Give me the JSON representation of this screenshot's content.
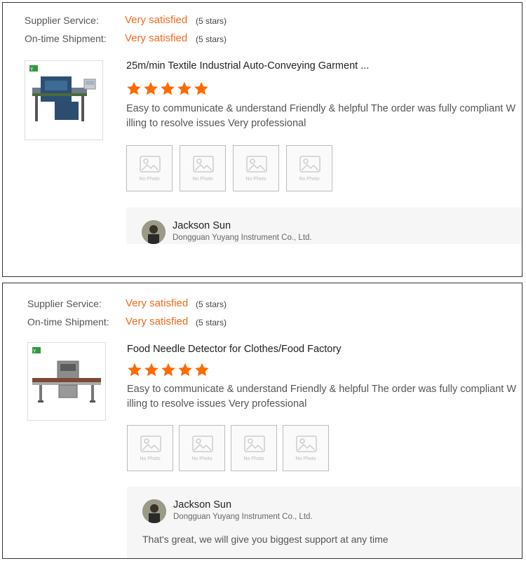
{
  "reviews": [
    {
      "supplier_service_label": "Supplier Service:",
      "supplier_service_value": "Very satisfied",
      "supplier_service_stars": "(5 stars)",
      "shipment_label": "On-time Shipment:",
      "shipment_value": "Very satisfied",
      "shipment_stars": "(5 stars)",
      "product_title": "25m/min Textile Industrial Auto-Conveying Garment ...",
      "rating": 5,
      "review_text": "Easy to communicate & understand Friendly & helpful The order was fully compliant Willing to resolve issues  Very professional",
      "photos": [
        "No Photo",
        "No Photo",
        "No Photo",
        "No Photo"
      ],
      "reply": {
        "name": "Jackson Sun",
        "company": "Dongguan Yuyang Instrument Co., Ltd."
      }
    },
    {
      "supplier_service_label": "Supplier Service:",
      "supplier_service_value": "Very satisfied",
      "supplier_service_stars": "(5 stars)",
      "shipment_label": "On-time Shipment:",
      "shipment_value": "Very satisfied",
      "shipment_stars": "(5 stars)",
      "product_title": "Food Needle Detector for Clothes/Food Factory",
      "rating": 5,
      "review_text": "Easy to communicate & understand Friendly & helpful The order was fully compliant Willing to resolve issues  Very professional",
      "photos": [
        "No Photo",
        "No Photo",
        "No Photo",
        "No Photo"
      ],
      "reply": {
        "name": "Jackson Sun",
        "company": "Dongguan Yuyang Instrument Co., Ltd.",
        "text": "That's great, we will give you biggest support at any time"
      }
    }
  ],
  "colors": {
    "accent": "#f26a1b",
    "star": "#ff6a00",
    "reply_bg": "#f6f6f6"
  },
  "icons": {
    "star": "star-icon",
    "photo_placeholder": "image-placeholder-icon",
    "logo": "brand-logo-icon"
  }
}
